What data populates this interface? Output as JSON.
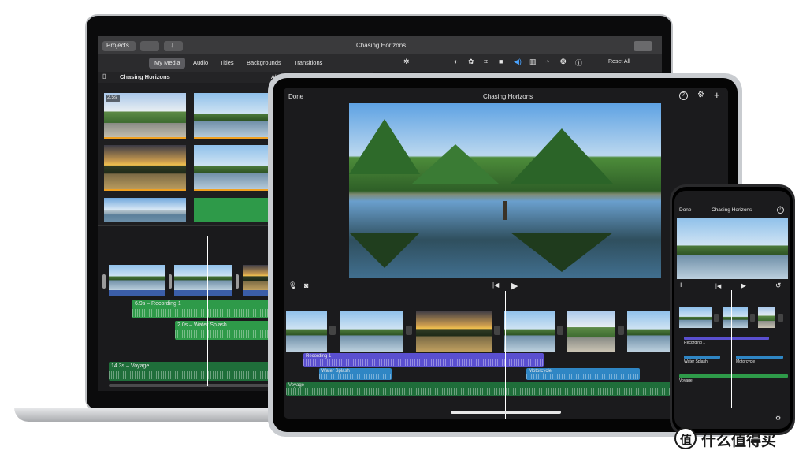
{
  "project_title": "Chasing Horizons",
  "mac": {
    "projects_button": "Projects",
    "tabs": [
      "My Media",
      "Audio",
      "Titles",
      "Backgrounds",
      "Transitions"
    ],
    "library_title": "Chasing Horizons",
    "filter_label": "All",
    "reset_label": "Reset All",
    "thumb_duration": "2.5s",
    "tracks": {
      "recording": "6.9s – Recording 1",
      "splash": "2.0s – Water Splash",
      "voyage": "14.3s – Voyage"
    }
  },
  "ipad": {
    "done_label": "Done",
    "help_icon": "?",
    "tracks": {
      "recording": "Recording 1",
      "splash": "Water Splash",
      "motorcycle": "Motorcycle",
      "voyage": "Voyage"
    }
  },
  "iphone": {
    "done_label": "Done",
    "help_icon": "?",
    "tracks": {
      "recording": "Recording 1",
      "splash": "Water Splash",
      "motorcycle": "Motorcycle",
      "voyage": "Voyage"
    }
  },
  "watermark": {
    "glyph": "值",
    "text": "什么值得买"
  },
  "colors": {
    "accent_blue": "#3b5ea8",
    "audio_green": "#2e9a49",
    "recording_purple": "#5a4fd0",
    "water_blue": "#2f86c4",
    "voyage_green": "#1f6e3a",
    "playhead": "#ffffff"
  }
}
